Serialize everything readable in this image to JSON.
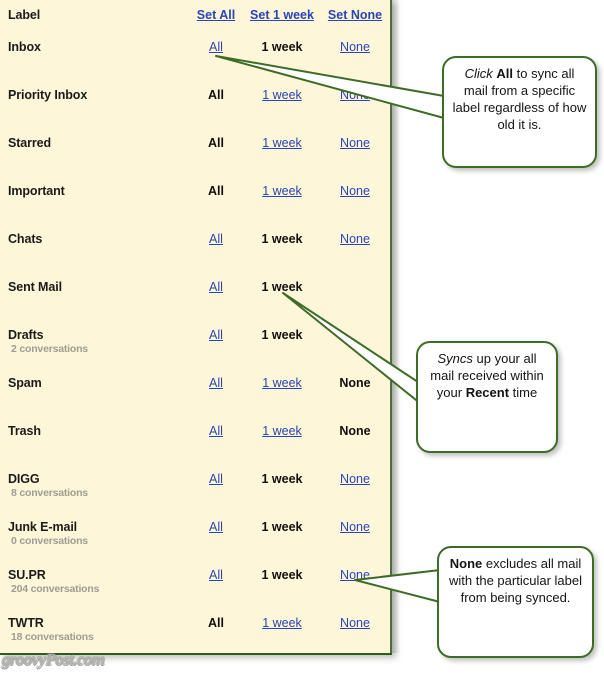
{
  "panel": {
    "header": {
      "label_col": "Label",
      "set_all": "Set All",
      "set_1week": "Set 1 week",
      "set_none": "Set None"
    },
    "rows": [
      {
        "label": "Inbox",
        "sub": "",
        "all": "All",
        "week": "1 week",
        "none": "None",
        "selected": "week"
      },
      {
        "label": "Priority Inbox",
        "sub": "",
        "all": "All",
        "week": "1 week",
        "none": "None",
        "selected": "all"
      },
      {
        "label": "Starred",
        "sub": "",
        "all": "All",
        "week": "1 week",
        "none": "None",
        "selected": "all"
      },
      {
        "label": "Important",
        "sub": "",
        "all": "All",
        "week": "1 week",
        "none": "None",
        "selected": "all"
      },
      {
        "label": "Chats",
        "sub": "",
        "all": "All",
        "week": "1 week",
        "none": "None",
        "selected": "week"
      },
      {
        "label": "Sent Mail",
        "sub": "",
        "all": "All",
        "week": "1 week",
        "none": "",
        "selected": "week"
      },
      {
        "label": "Drafts",
        "sub": "2 conversations",
        "all": "All",
        "week": "1 week",
        "none": "",
        "selected": "week"
      },
      {
        "label": "Spam",
        "sub": "",
        "all": "All",
        "week": "1 week",
        "none": "None",
        "selected": "none"
      },
      {
        "label": "Trash",
        "sub": "",
        "all": "All",
        "week": "1 week",
        "none": "None",
        "selected": "none"
      },
      {
        "label": "DIGG",
        "sub": "8 conversations",
        "all": "All",
        "week": "1 week",
        "none": "None",
        "selected": "week"
      },
      {
        "label": "Junk E-mail",
        "sub": "0 conversations",
        "all": "All",
        "week": "1 week",
        "none": "None",
        "selected": "week"
      },
      {
        "label": "SU.PR",
        "sub": "204 conversations",
        "all": "All",
        "week": "1 week",
        "none": "None",
        "selected": "week"
      },
      {
        "label": "TWTR",
        "sub": "18 conversations",
        "all": "All",
        "week": "1 week",
        "none": "None",
        "selected": "all"
      }
    ]
  },
  "callouts": [
    {
      "id": "callout1",
      "html": "<i>Click</i> <b>All</b> to sync all mail from a specific label regardless of how old it is."
    },
    {
      "id": "callout2",
      "html": "<i>Syncs</i> up your all mail received within your <b>Recent</b> time"
    },
    {
      "id": "callout3",
      "html": "<b>None</b> excludes all mail with the particular label from being synced."
    }
  ],
  "watermark": "groovyPost.com",
  "colors": {
    "panel_bg": "#fdf6d8",
    "panel_border": "#2e5b1e",
    "link": "#2b44b8",
    "selected_text": "#101010",
    "sub_text": "#9d9d94",
    "callout_border": "#3e6b26"
  }
}
